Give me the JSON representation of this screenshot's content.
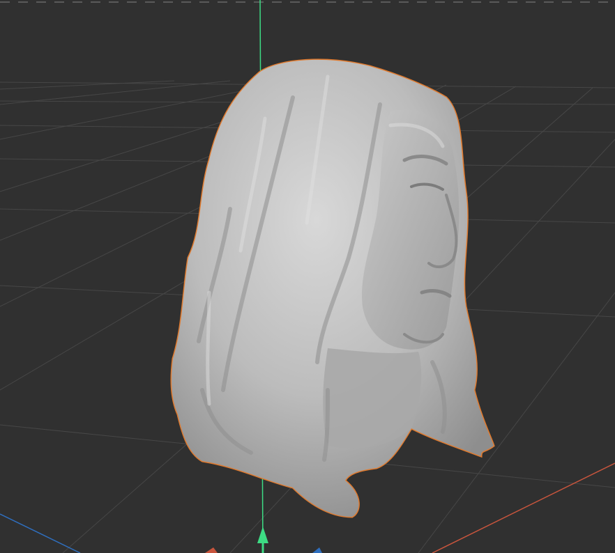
{
  "viewport": {
    "background_color": "#303030",
    "grid_line_color": "#454545",
    "y_axis_color": "#3ddc84",
    "x_axis_color": "#c8553d",
    "z_axis_color": "#2f6fbf",
    "selection_outline_color": "#e07a2e",
    "mesh_base_color": "#b9b9b9"
  },
  "scene": {
    "object": "sculpted-head-mesh",
    "selected": true
  },
  "gizmo": {
    "icon": "move-gizmo-y-arrow-icon"
  }
}
